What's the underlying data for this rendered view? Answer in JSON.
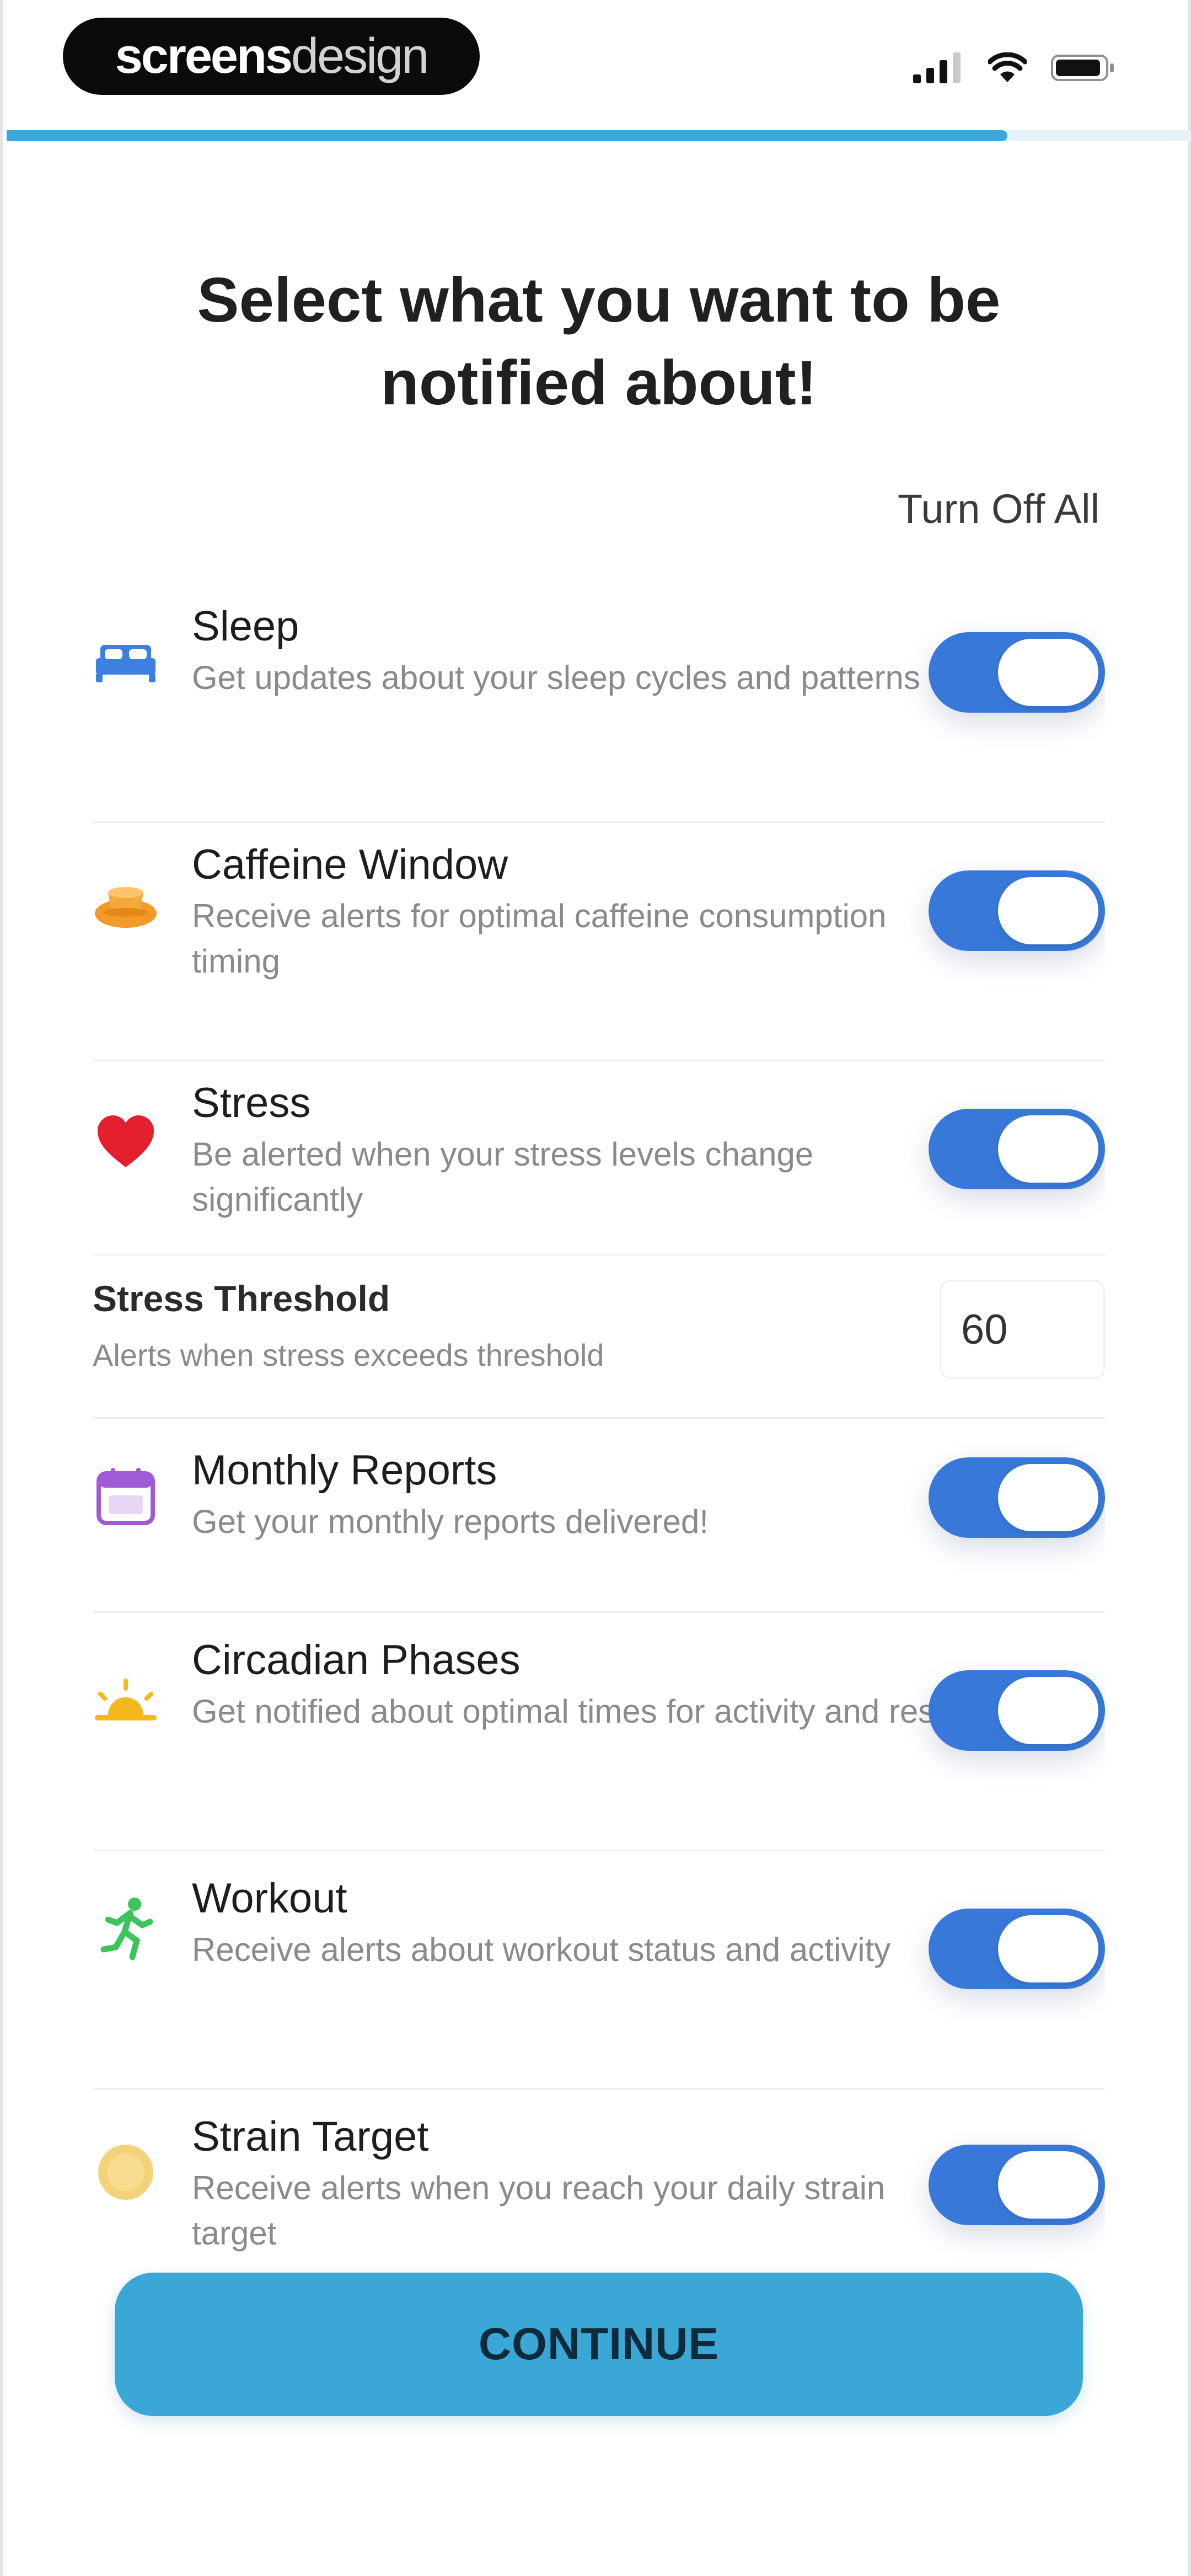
{
  "brand": {
    "bold": "screens",
    "light": "design"
  },
  "progress_fraction": 0.845,
  "title": "Select what you want to be notified about!",
  "turn_off_all_label": "Turn Off All",
  "items": [
    {
      "title": "Sleep",
      "description": "Get updates about your sleep cycles and patterns",
      "icon": "bed-icon",
      "enabled": true
    },
    {
      "title": "Caffeine Window",
      "description": "Receive alerts for optimal caffeine consumption timing",
      "icon": "coffee-icon",
      "enabled": true
    },
    {
      "title": "Stress",
      "description": "Be alerted when your stress levels change significantly",
      "icon": "heart-icon",
      "enabled": true
    },
    {
      "title": "Monthly Reports",
      "description": "Get your monthly reports delivered!",
      "icon": "calendar-icon",
      "enabled": true
    },
    {
      "title": "Circadian Phases",
      "description": "Get notified about optimal times for activity and rest",
      "icon": "sun-icon",
      "enabled": true
    },
    {
      "title": "Workout",
      "description": "Receive alerts about workout status and activity",
      "icon": "running-icon",
      "enabled": true
    },
    {
      "title": "Strain Target",
      "description": "Receive alerts when you reach your daily strain target",
      "icon": "strain-circle-icon",
      "enabled": true
    }
  ],
  "stress_threshold": {
    "title": "Stress Threshold",
    "description": "Alerts when stress exceeds threshold",
    "value": "60"
  },
  "continue_label": "CONTINUE",
  "colors": {
    "accent": "#3878d8",
    "progress": "#3aa7d8",
    "continue": "#3aa7d6",
    "sleep_icon": "#3c7fe0",
    "caffeine_icon": "#f39a2a",
    "heart_icon": "#e4202e",
    "calendar_icon": "#a05ad8",
    "sun_icon": "#f5b81c",
    "workout_icon": "#3cc45a",
    "strain_icon": "#f4d27a"
  }
}
